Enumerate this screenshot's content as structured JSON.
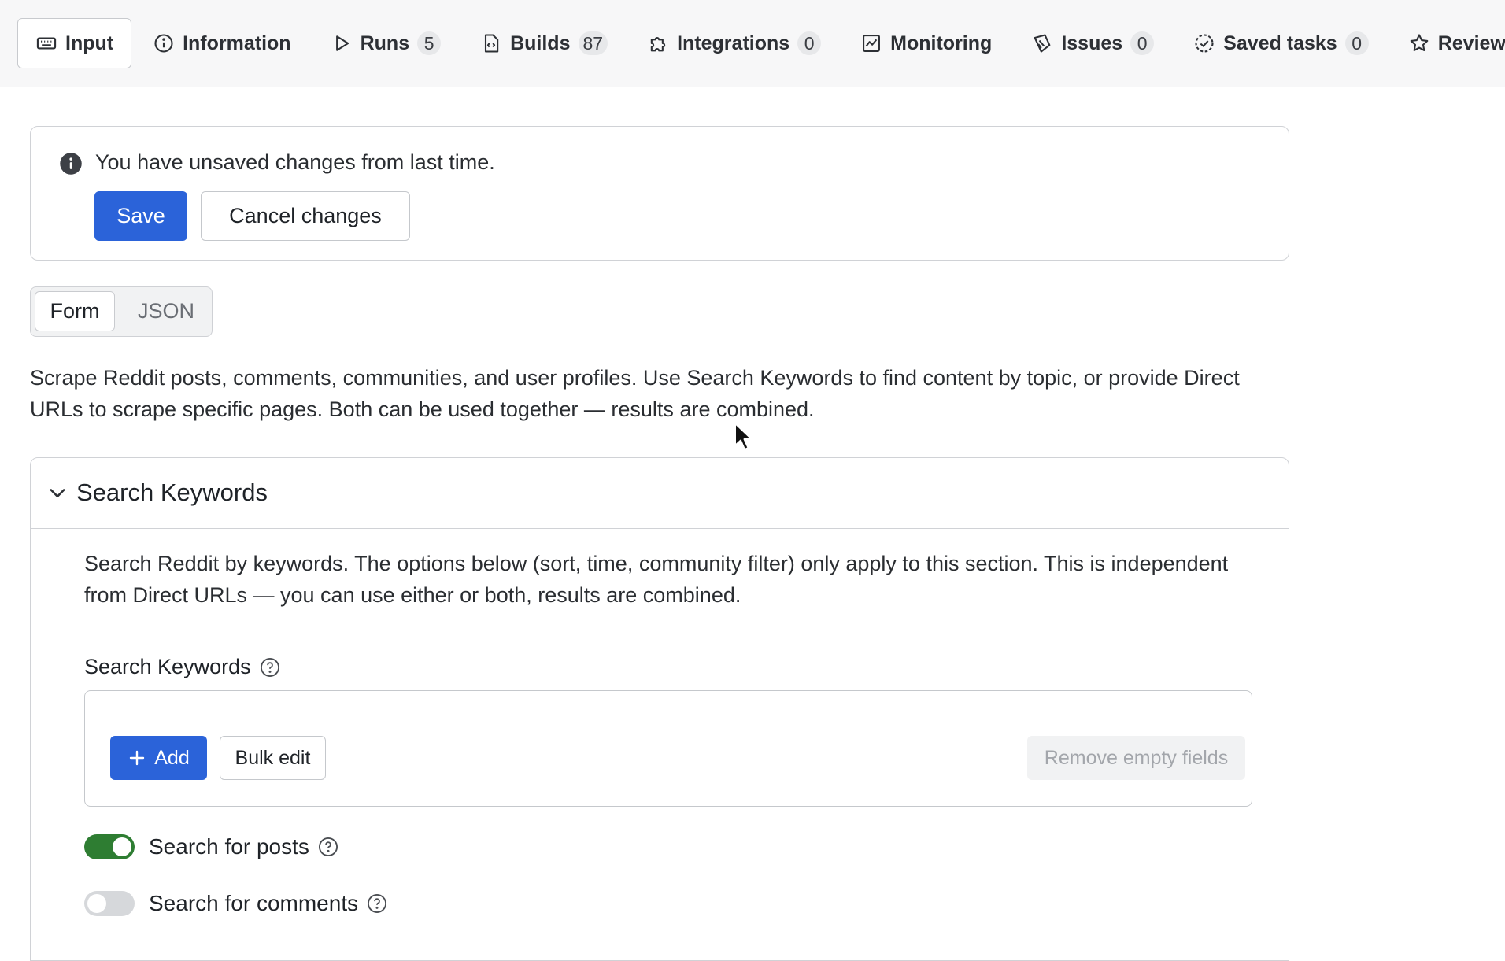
{
  "tabs": [
    {
      "label": "Input",
      "icon": "keyboard-icon",
      "active": true
    },
    {
      "label": "Information",
      "icon": "info-icon"
    },
    {
      "label": "Runs",
      "icon": "play-icon",
      "count": "5"
    },
    {
      "label": "Builds",
      "icon": "file-code-icon",
      "count": "87"
    },
    {
      "label": "Integrations",
      "icon": "puzzle-icon",
      "count": "0"
    },
    {
      "label": "Monitoring",
      "icon": "chart-icon"
    },
    {
      "label": "Issues",
      "icon": "bug-icon",
      "count": "0"
    },
    {
      "label": "Saved tasks",
      "icon": "task-check-icon",
      "count": "0"
    },
    {
      "label": "Reviews",
      "icon": "star-icon"
    }
  ],
  "notice": {
    "message": "You have unsaved changes from last time.",
    "save_label": "Save",
    "cancel_label": "Cancel changes"
  },
  "view_toggle": {
    "form_label": "Form",
    "json_label": "JSON",
    "selected": "Form"
  },
  "description": "Scrape Reddit posts, comments, communities, and user profiles. Use Search Keywords to find content by topic, or provide Direct URLs to scrape specific pages. Both can be used together — results are combined.",
  "section": {
    "title": "Search Keywords",
    "expanded": true,
    "description": "Search Reddit by keywords. The options below (sort, time, community filter) only apply to this section. This is independent from Direct URLs — you can use either or both, results are combined.",
    "field_label": "Search Keywords",
    "add_label": "Add",
    "bulk_edit_label": "Bulk edit",
    "remove_empty_label": "Remove empty fields",
    "toggles": [
      {
        "label": "Search for posts",
        "on": true
      },
      {
        "label": "Search for comments",
        "on": false
      }
    ]
  },
  "colors": {
    "primary": "#2b63d9",
    "toggle_on": "#2e7d32",
    "toggle_off": "#d6d8db"
  }
}
